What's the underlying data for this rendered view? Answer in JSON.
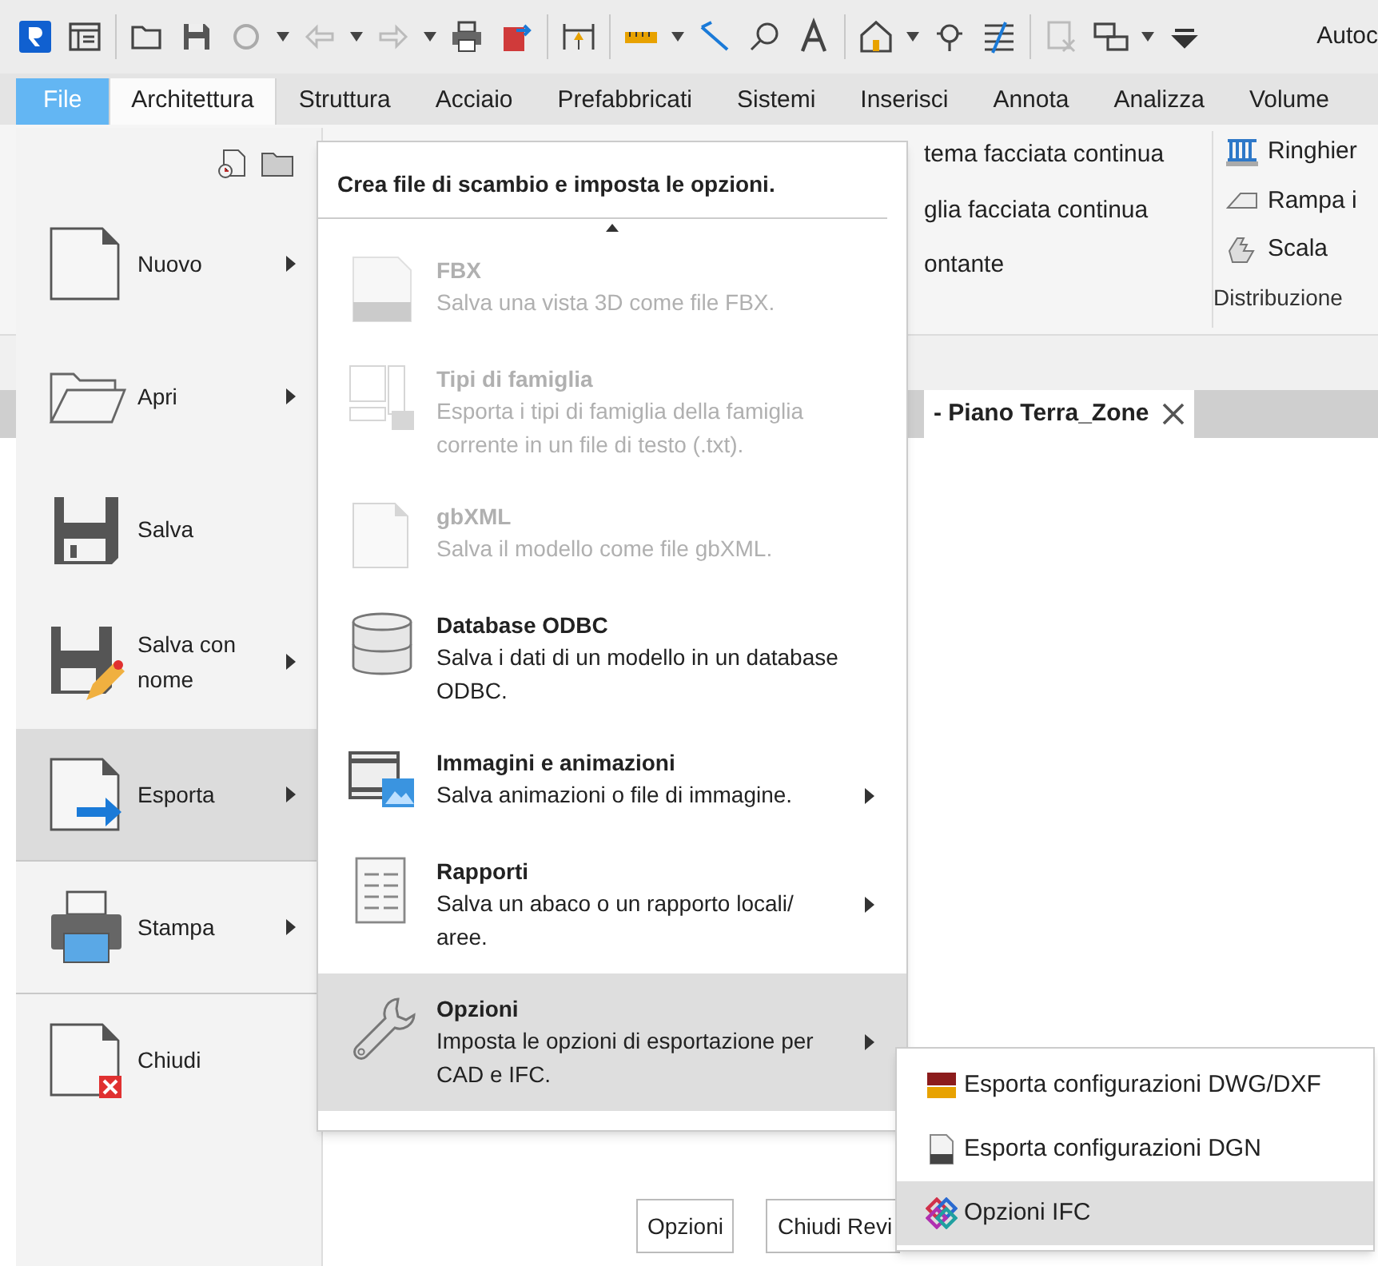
{
  "app_title": "Autoc",
  "file_tab": {
    "label": "File",
    "open": true
  },
  "ribbon_tabs": [
    {
      "label": "Architettura",
      "selected": true
    },
    {
      "label": "Struttura",
      "selected": false
    },
    {
      "label": "Acciaio",
      "selected": false
    },
    {
      "label": "Prefabbricati",
      "selected": false
    },
    {
      "label": "Sistemi",
      "selected": false
    },
    {
      "label": "Inserisci",
      "selected": false
    },
    {
      "label": "Annota",
      "selected": false
    },
    {
      "label": "Analizza",
      "selected": false
    },
    {
      "label": "Volume",
      "selected": false
    }
  ],
  "ribbon_panel": {
    "column_1": [
      "tema facciata continua",
      "glia facciata continua",
      "ontante"
    ],
    "column_2": [
      "Ringhier",
      "Rampa i",
      "Scala"
    ],
    "group_label": "Distribuzione"
  },
  "view_tab": {
    "title": "- Piano Terra_Zone"
  },
  "file_menu": {
    "items": [
      {
        "label": "Nuovo",
        "submenu": true,
        "selected": false,
        "divider_after": false
      },
      {
        "label": "Apri",
        "submenu": true,
        "selected": false,
        "divider_after": false
      },
      {
        "label": "Salva",
        "submenu": false,
        "selected": false,
        "divider_after": false
      },
      {
        "label": "Salva con nome",
        "submenu": true,
        "selected": false,
        "divider_after": false
      },
      {
        "label": "Esporta",
        "submenu": true,
        "selected": true,
        "divider_after": true
      },
      {
        "label": "Stampa",
        "submenu": true,
        "selected": false,
        "divider_after": true
      },
      {
        "label": "Chiudi",
        "submenu": false,
        "selected": false,
        "divider_after": false
      }
    ]
  },
  "export_panel": {
    "heading": "Crea file di scambio e imposta le opzioni.",
    "items": [
      {
        "title": "FBX",
        "description": "Salva una vista 3D come file FBX.",
        "disabled": true,
        "submenu": false,
        "selected": false
      },
      {
        "title": "Tipi di famiglia",
        "description": "Esporta i tipi di famiglia della famiglia corrente in un file di testo (.txt).",
        "disabled": true,
        "submenu": false,
        "selected": false
      },
      {
        "title": "gbXML",
        "description": "Salva il modello come file gbXML.",
        "disabled": true,
        "submenu": false,
        "selected": false
      },
      {
        "title": "Database ODBC",
        "description": "Salva i dati di un modello in un database ODBC.",
        "disabled": false,
        "submenu": false,
        "selected": false
      },
      {
        "title": "Immagini e animazioni",
        "description": "Salva animazioni o file di immagine.",
        "disabled": false,
        "submenu": true,
        "selected": false
      },
      {
        "title": "Rapporti",
        "description": "Salva un abaco o un rapporto locali/ aree.",
        "disabled": false,
        "submenu": true,
        "selected": false
      },
      {
        "title": "Opzioni",
        "description": "Imposta le opzioni di esportazione per CAD e IFC.",
        "disabled": false,
        "submenu": true,
        "selected": true
      }
    ]
  },
  "footer_buttons": [
    "Opzioni",
    "Chiudi Revi"
  ],
  "submenu": {
    "items": [
      {
        "label": "Esporta configurazioni DWG/DXF",
        "selected": false
      },
      {
        "label": "Esporta configurazioni DGN",
        "selected": false
      },
      {
        "label": "Opzioni IFC",
        "selected": true
      }
    ]
  }
}
